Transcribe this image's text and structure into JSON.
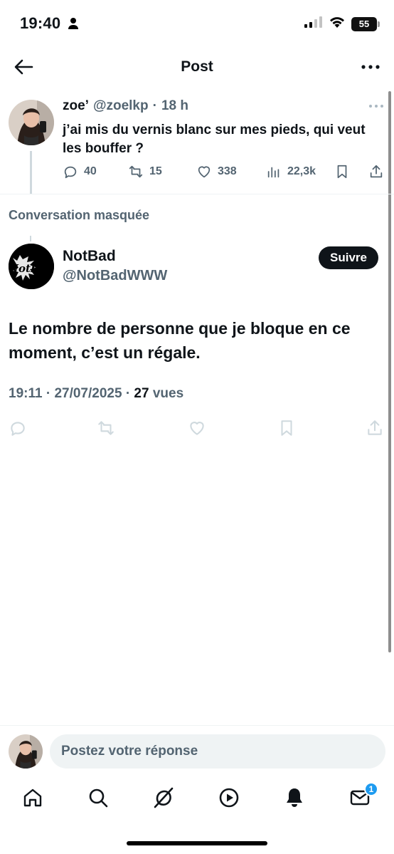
{
  "status_bar": {
    "time": "19:40",
    "battery": "55"
  },
  "header": {
    "title": "Post"
  },
  "parent_tweet": {
    "name": "zoe’",
    "handle": "@zoelkp",
    "dot": "·",
    "age": "18 h",
    "text": "j’ai mis du vernis blanc sur mes pieds, qui veut les bouffer ?",
    "replies": "40",
    "reposts": "15",
    "likes": "338",
    "views": "22,3k"
  },
  "hidden_conversation_label": "Conversation masquée",
  "main_tweet": {
    "name": "NotBad",
    "handle": "@NotBadWWW",
    "follow_label": "Suivre",
    "avatar_text": "NotBad",
    "text": "Le nombre de personne que je bloque en ce moment, c’est un régale.",
    "time": "19:11",
    "date": "27/07/2025",
    "views_count": "27",
    "views_label": "vues"
  },
  "reply_bar": {
    "placeholder": "Postez votre réponse"
  },
  "tab_bar": {
    "items": [
      "home-icon",
      "search-icon",
      "grok-icon",
      "video-icon",
      "notifications-icon",
      "messages-icon"
    ],
    "messages_badge": "1"
  },
  "colors": {
    "accent": "#1d9bf0",
    "text": "#0f1419",
    "muted": "#536471",
    "follow_bg": "#0f1419"
  }
}
